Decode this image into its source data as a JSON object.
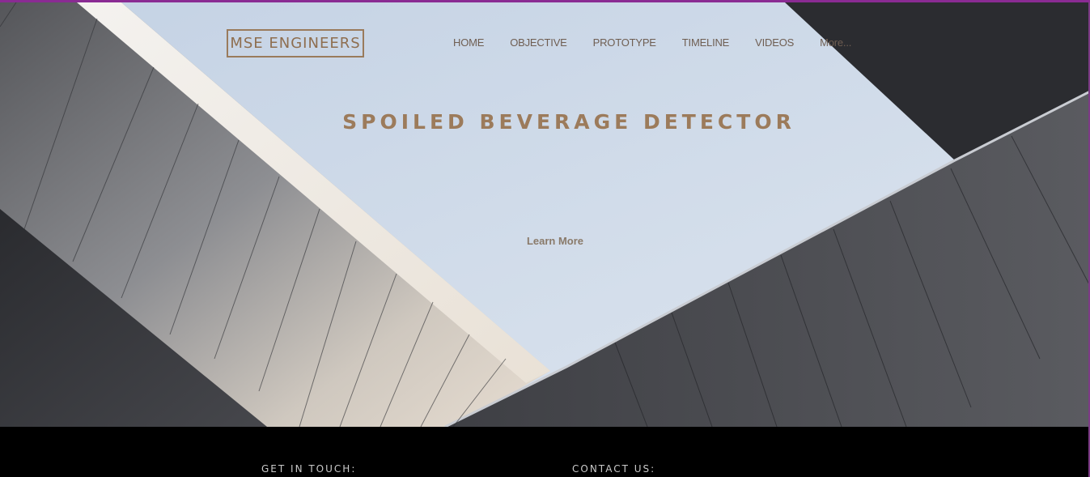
{
  "site": {
    "logo_text": "MSE ENGINEERS"
  },
  "nav": {
    "items": [
      {
        "label": "HOME"
      },
      {
        "label": "OBJECTIVE"
      },
      {
        "label": "PROTOTYPE"
      },
      {
        "label": "TIMELINE"
      },
      {
        "label": "VIDEOS"
      },
      {
        "label": "More..."
      }
    ]
  },
  "hero": {
    "title": "SPOILED BEVERAGE DETECTOR",
    "cta_label": "Learn More"
  },
  "footer": {
    "get_in_touch": "GET IN TOUCH:",
    "contact_us": "CONTACT US:"
  },
  "colors": {
    "accent": "#9c7b5b",
    "border_purple": "#8a2b93",
    "footer_bg": "#000000"
  }
}
